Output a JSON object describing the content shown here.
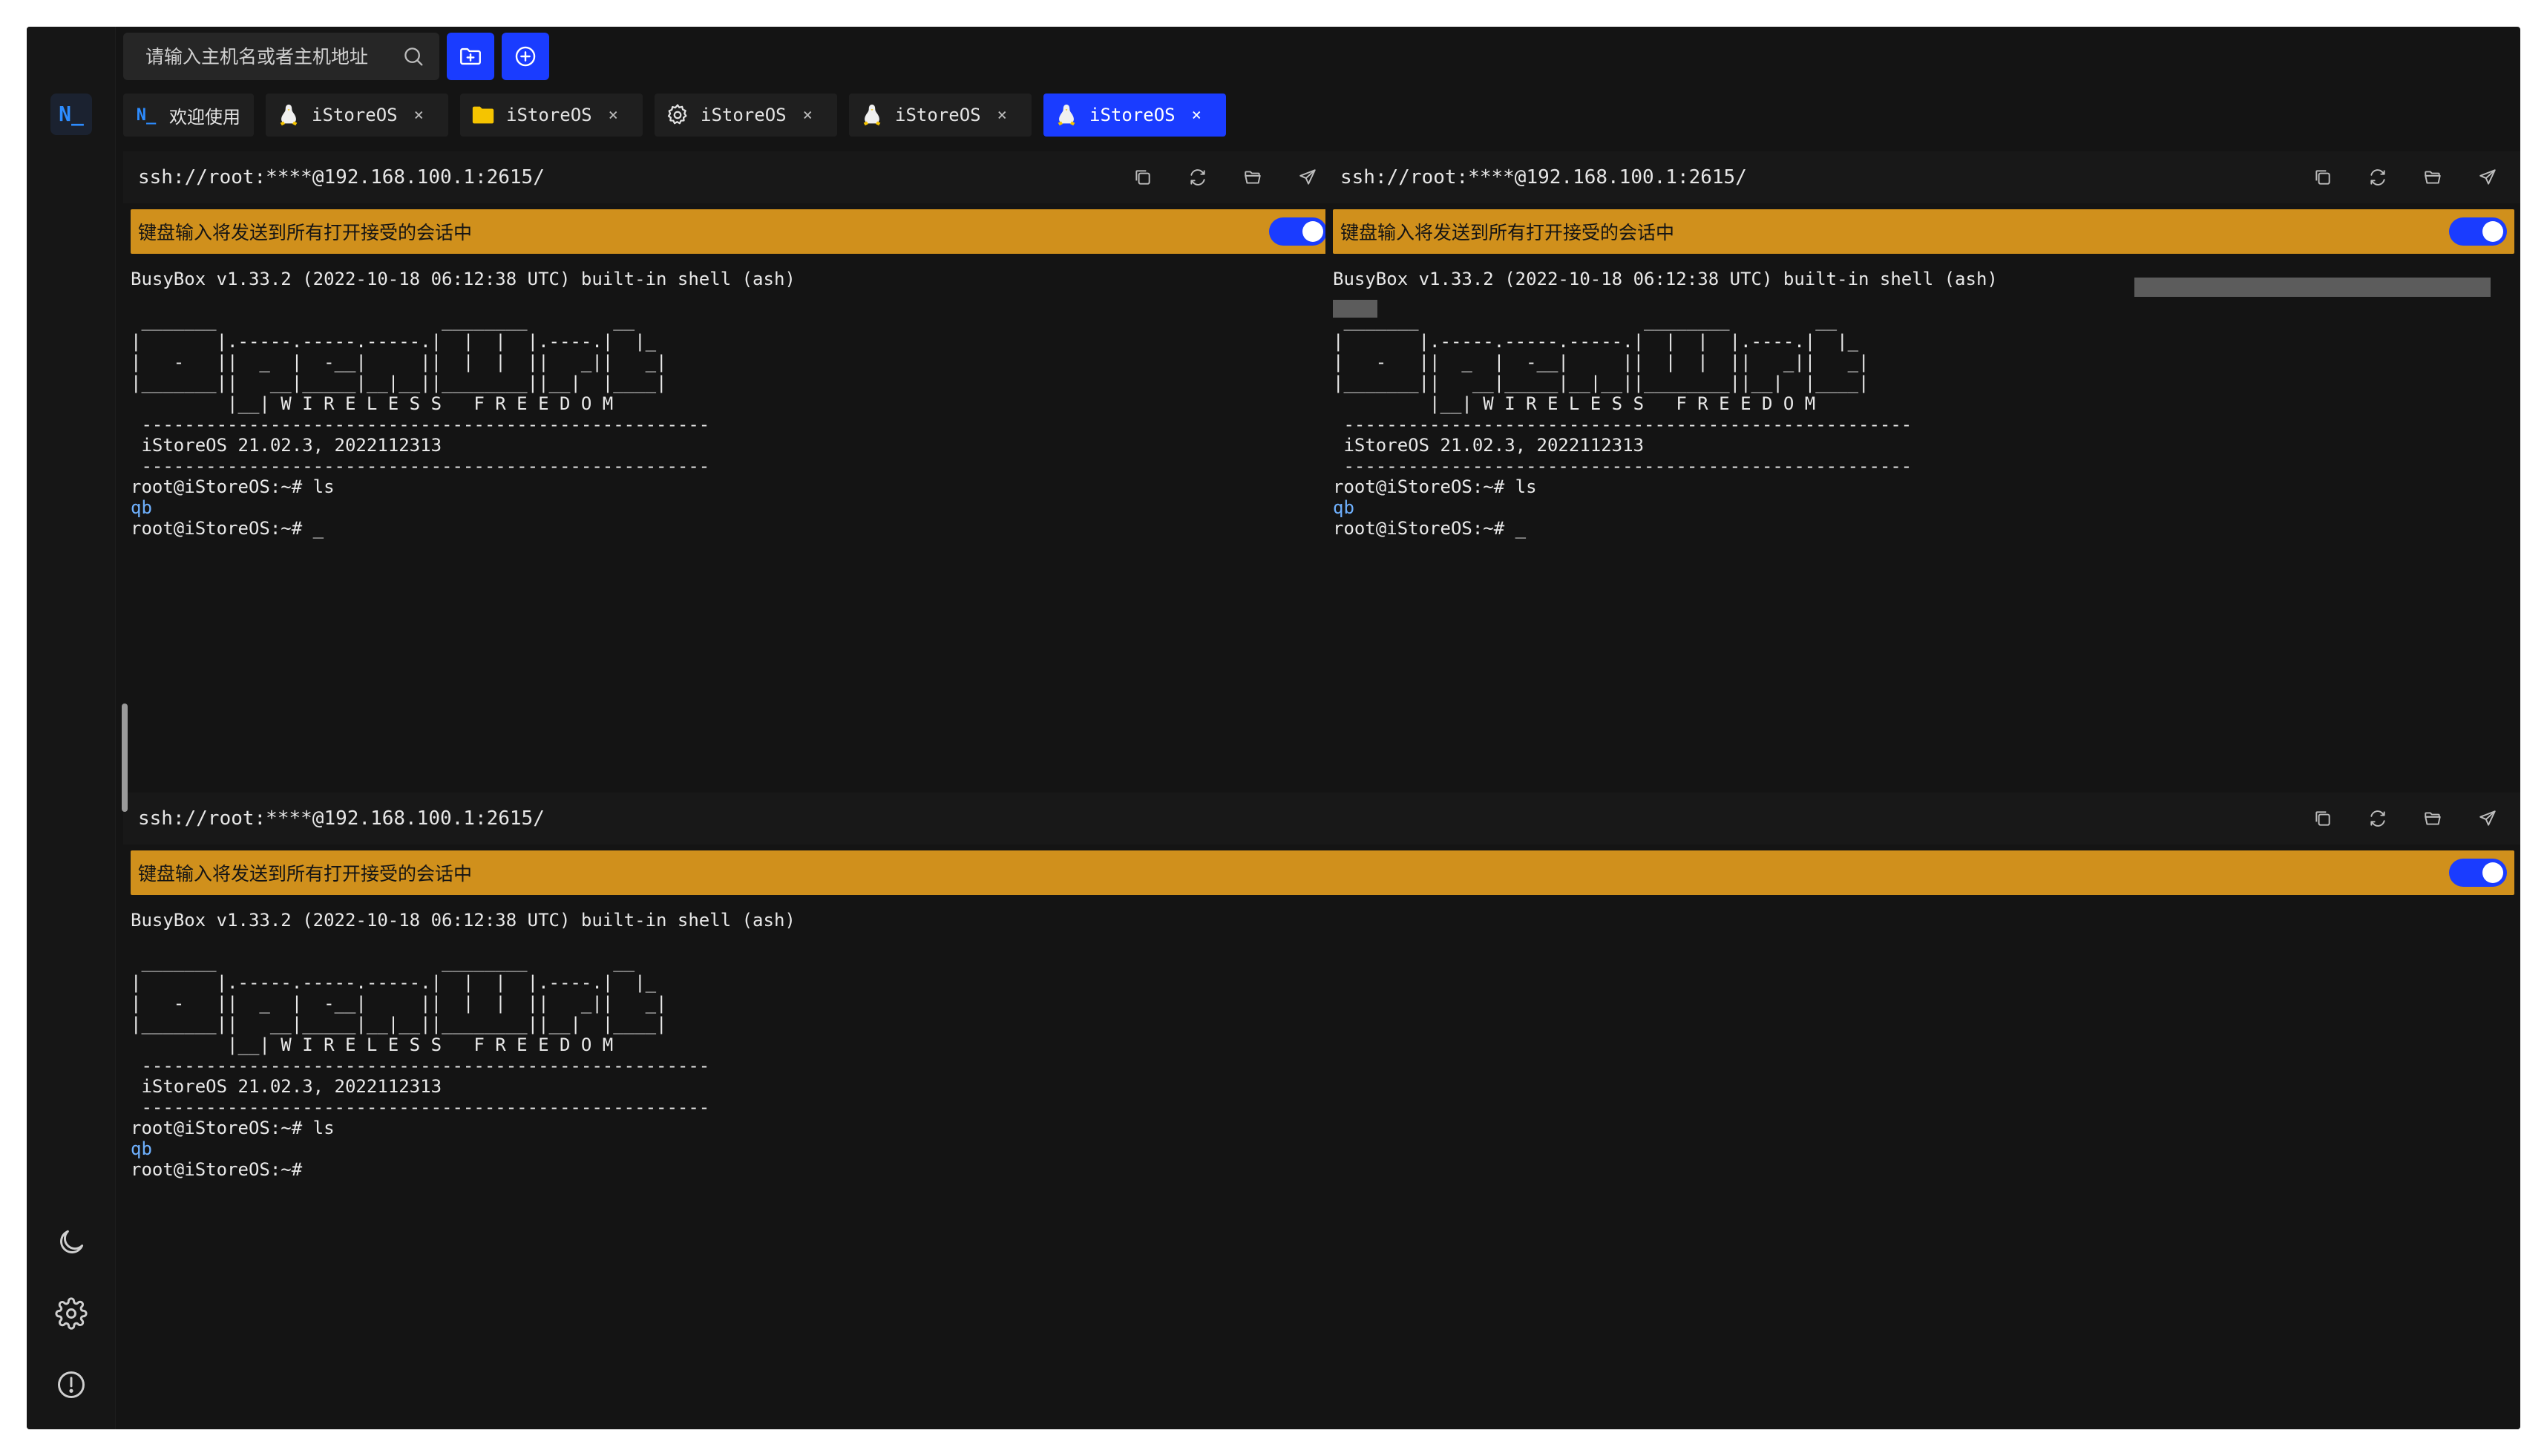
{
  "colors": {
    "background": "#141414",
    "accent": "#1a3cff",
    "broadcast": "#d0901c",
    "linux": "#f5c400",
    "folder": "#f5c400"
  },
  "sidebar": {
    "logo": "N_",
    "bottom_icons": [
      "moon-icon",
      "gear-icon",
      "info-icon"
    ]
  },
  "search": {
    "placeholder": "请输入主机名或者主机地址",
    "value": ""
  },
  "toolbar": {
    "buttons": [
      "folder-plus-icon",
      "plus-circle-icon"
    ]
  },
  "tabs": [
    {
      "logo": "N_",
      "label": "欢迎使用",
      "icon": "app-logo-icon",
      "closable": false,
      "active": false
    },
    {
      "label": "iStoreOS",
      "icon": "linux-icon",
      "closable": true,
      "close": "×",
      "active": false
    },
    {
      "label": "iStoreOS",
      "icon": "folder-icon",
      "closable": true,
      "close": "×",
      "active": false
    },
    {
      "label": "iStoreOS",
      "icon": "gear-icon",
      "closable": true,
      "close": "×",
      "active": false
    },
    {
      "label": "iStoreOS",
      "icon": "linux-icon",
      "closable": true,
      "close": "×",
      "active": false
    },
    {
      "label": "iStoreOS",
      "icon": "linux-icon",
      "closable": true,
      "close": "×",
      "active": true
    }
  ],
  "panes": [
    {
      "url": "ssh://root:****@192.168.100.1:2615/",
      "broadcast": "键盘输入将发送到所有打开接受的会话中",
      "broadcast_enabled": true,
      "terminal": {
        "line1": "BusyBox v1.33.2 (2022-10-18 06:12:38 UTC) built-in shell (ash)",
        "art": " _______                     ________        __\n|       |.-----.-----.-----.|  |  |  |.----.|  |_\n|   -   ||  _  |  -__|     ||  |  |  ||   _||   _|\n|_______||   __|_____|__|__||________||__|  |____|\n         |__| W I R E L E S S   F R E E D O M\n -----------------------------------------------------",
        "version": " iStoreOS 21.02.3, 2022112313",
        "separator": " -----------------------------------------------------",
        "cmd1": "root@iStoreOS:~# ls",
        "out1": "qb",
        "prompt": "root@iStoreOS:~# _"
      }
    },
    {
      "url": "ssh://root:****@192.168.100.1:2615/",
      "broadcast": "键盘输入将发送到所有打开接受的会话中",
      "broadcast_enabled": true,
      "terminal": {
        "line1": "BusyBox v1.33.2 (2022-10-18 06:12:38 UTC) built-in shell (ash)",
        "art": " _______                     ________        __\n|       |.-----.-----.-----.|  |  |  |.----.|  |_\n|   -   ||  _  |  -__|     ||  |  |  ||   _||   _|\n|_______||   __|_____|__|__||________||__|  |____|\n         |__| W I R E L E S S   F R E E D O M\n -----------------------------------------------------",
        "version": " iStoreOS 21.02.3, 2022112313",
        "separator": " -----------------------------------------------------",
        "cmd1": "root@iStoreOS:~# ls",
        "out1": "qb",
        "prompt": "root@iStoreOS:~# _"
      }
    },
    {
      "url": "ssh://root:****@192.168.100.1:2615/",
      "broadcast": "键盘输入将发送到所有打开接受的会话中",
      "broadcast_enabled": true,
      "terminal": {
        "line1": "BusyBox v1.33.2 (2022-10-18 06:12:38 UTC) built-in shell (ash)",
        "art": " _______                     ________        __\n|       |.-----.-----.-----.|  |  |  |.----.|  |_\n|   -   ||  _  |  -__|     ||  |  |  ||   _||   _|\n|_______||   __|_____|__|__||________||__|  |____|\n         |__| W I R E L E S S   F R E E D O M\n -----------------------------------------------------",
        "version": " iStoreOS 21.02.3, 2022112313",
        "separator": " -----------------------------------------------------",
        "cmd1": "root@iStoreOS:~# ls",
        "out1": "qb",
        "prompt": "root@iStoreOS:~#"
      }
    }
  ],
  "pane_tools": [
    "copy-icon",
    "refresh-icon",
    "folder-open-icon",
    "send-icon"
  ]
}
